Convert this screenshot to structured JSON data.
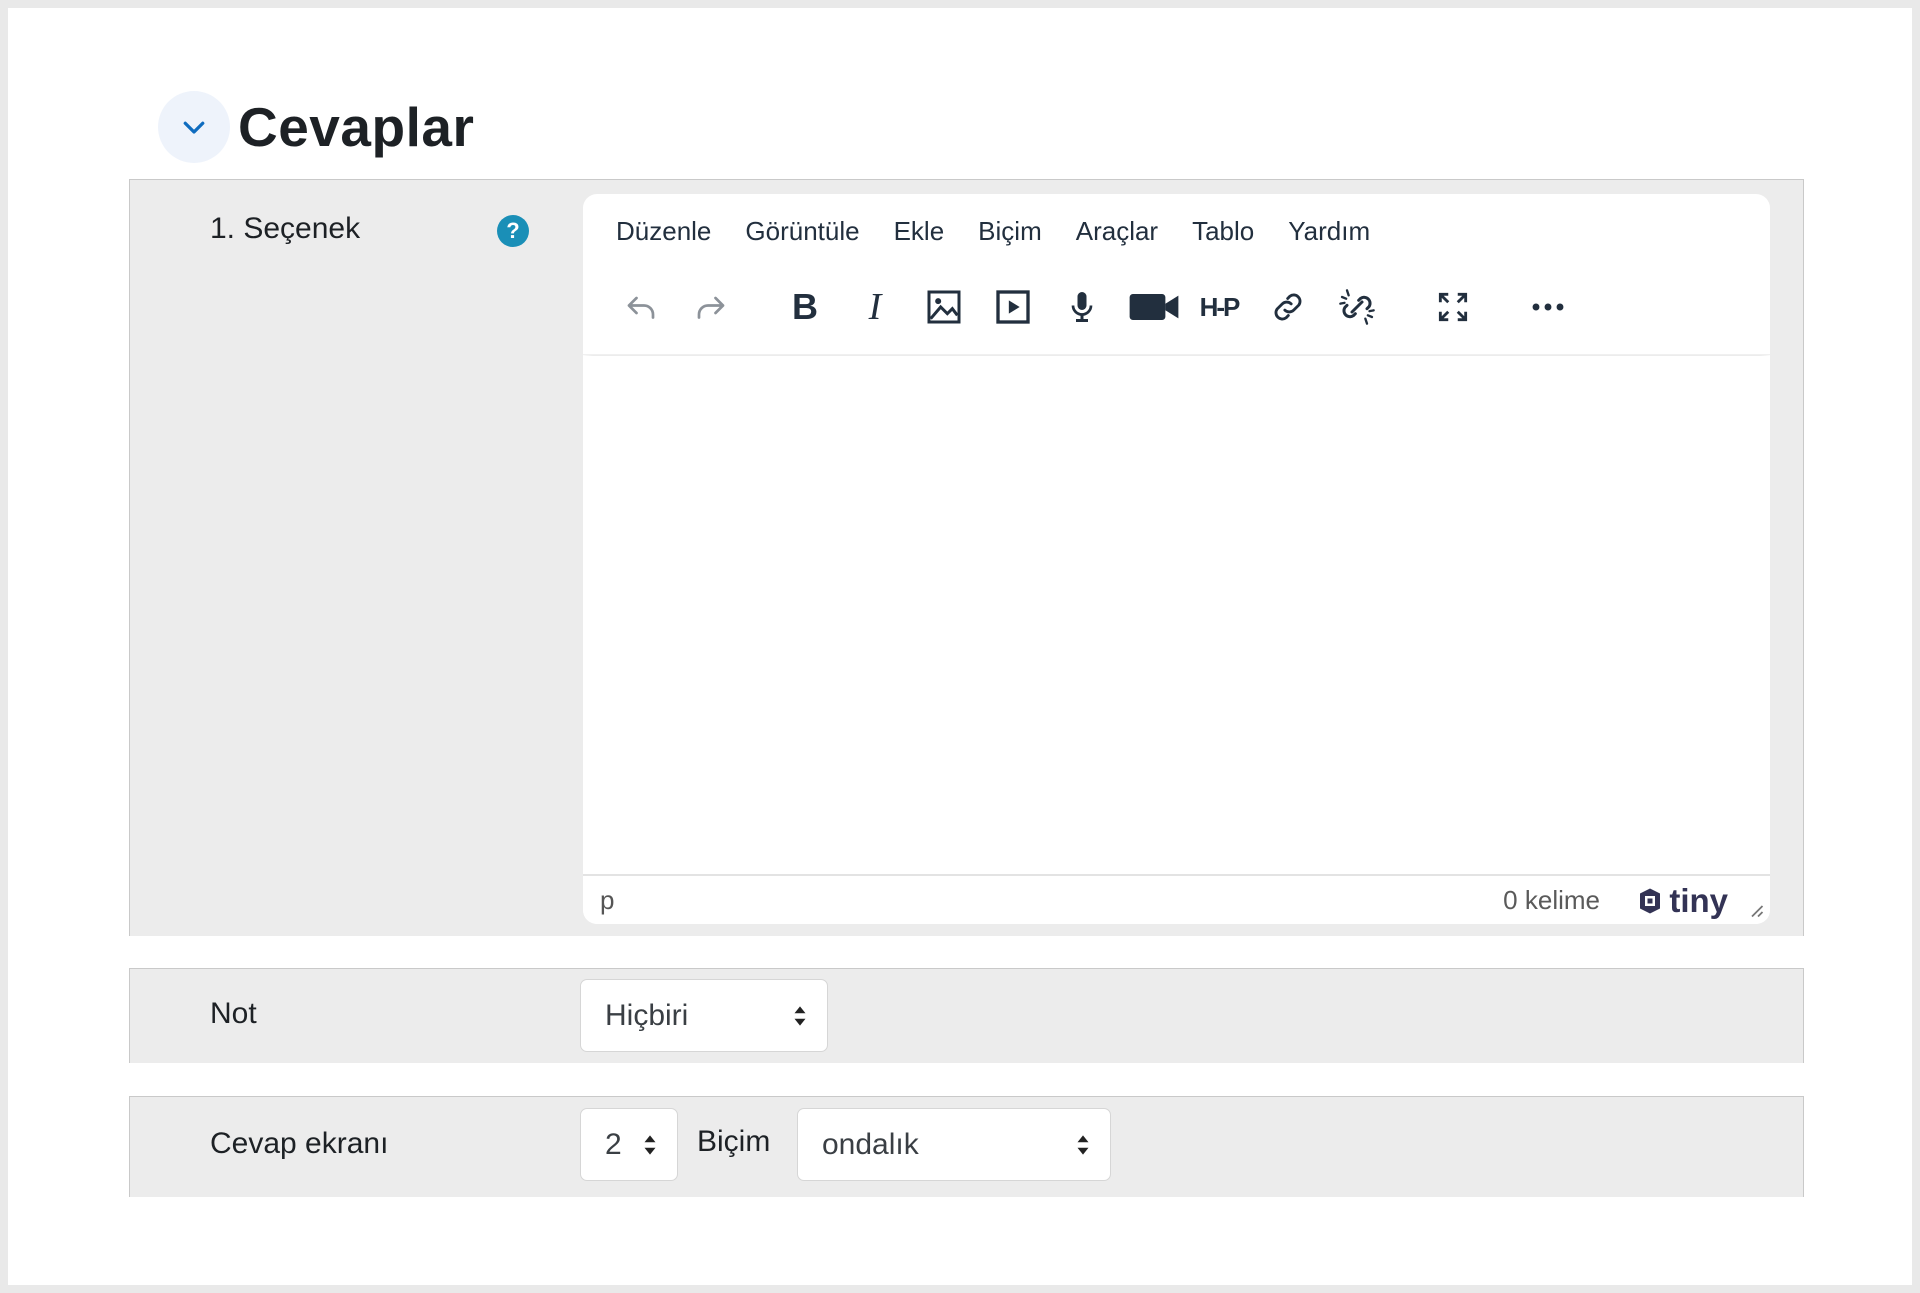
{
  "section": {
    "title": "Cevaplar"
  },
  "answer": {
    "label": "1. Seçenek",
    "help_icon": "question-circle-icon"
  },
  "editor": {
    "menu": [
      "Düzenle",
      "Görüntüle",
      "Ekle",
      "Biçim",
      "Araçlar",
      "Tablo",
      "Yardım"
    ],
    "toolbar_icons": [
      "undo-icon",
      "redo-icon",
      "bold-icon",
      "italic-icon",
      "image-icon",
      "media-icon",
      "microphone-icon",
      "video-camera-icon",
      "h5p-icon",
      "link-icon",
      "unlink-icon",
      "fullscreen-icon",
      "more-icon"
    ],
    "bold_glyph": "B",
    "italic_glyph": "I",
    "h5p_glyph": "H-P",
    "status_path": "p",
    "word_count": "0 kelime",
    "brand": "tiny"
  },
  "grade": {
    "label": "Not",
    "selected": "Hiçbiri"
  },
  "answer_display": {
    "label": "Cevap ekranı",
    "decimals_selected": "2",
    "format_label": "Biçim",
    "format_selected": "ondalık"
  },
  "colors": {
    "help_icon": "#1a8fb7",
    "row_background": "#ececec",
    "collapse_button": "#eef3fb",
    "collapse_chevron": "#0f6cbf"
  }
}
